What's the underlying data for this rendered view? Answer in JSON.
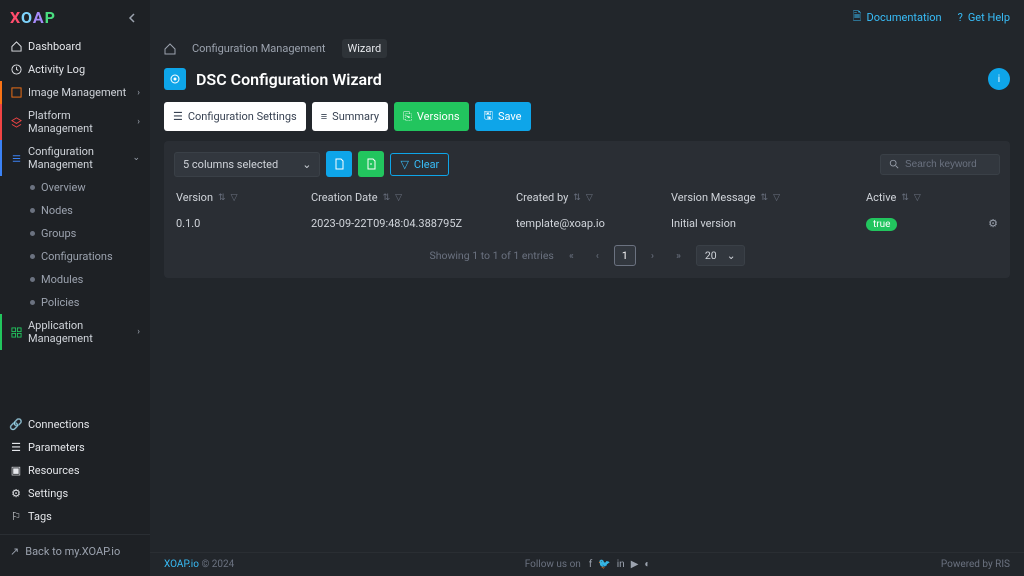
{
  "brand": "XOAP",
  "topLinks": {
    "doc": "Documentation",
    "help": "Get Help"
  },
  "nav": {
    "dashboard": "Dashboard",
    "activity": "Activity Log",
    "image": "Image Management",
    "platform": "Platform Management",
    "config": "Configuration Management",
    "config_items": {
      "overview": "Overview",
      "nodes": "Nodes",
      "groups": "Groups",
      "configurations": "Configurations",
      "modules": "Modules",
      "policies": "Policies"
    },
    "app": "Application Management",
    "bottom": {
      "connections": "Connections",
      "parameters": "Parameters",
      "resources": "Resources",
      "settings": "Settings",
      "tags": "Tags"
    },
    "back": "Back to my.XOAP.io"
  },
  "breadcrumb": {
    "l1": "Configuration Management",
    "l2": "Wizard"
  },
  "page": {
    "title": "DSC Configuration Wizard",
    "avatar": "i"
  },
  "tabs": {
    "settings": "Configuration Settings",
    "summary": "Summary",
    "versions": "Versions",
    "save": "Save"
  },
  "toolbar": {
    "columns": "5 columns selected",
    "clear": "Clear",
    "searchPlaceholder": "Search keyword"
  },
  "table": {
    "headers": {
      "version": "Version",
      "creation": "Creation Date",
      "by": "Created by",
      "msg": "Version Message",
      "active": "Active"
    },
    "row": {
      "version": "0.1.0",
      "creation": "2023-09-22T09:48:04.388795Z",
      "by": "template@xoap.io",
      "msg": "Initial version",
      "active": "true"
    }
  },
  "pagination": {
    "info": "Showing 1 to 1 of 1 entries",
    "page": "1",
    "size": "20"
  },
  "footer": {
    "brand": "XOAP.io",
    "copy": "© 2024",
    "follow": "Follow us on",
    "powered": "Powered by RIS"
  }
}
